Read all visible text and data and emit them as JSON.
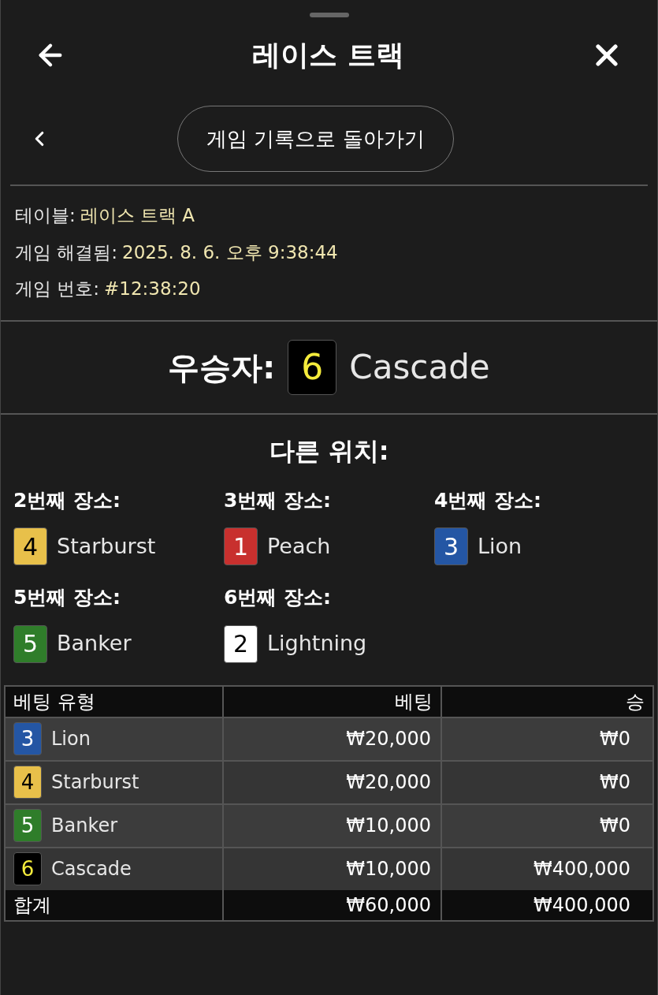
{
  "header": {
    "title": "레이스 트랙"
  },
  "back_link": {
    "label": "게임 기록으로 돌아가기"
  },
  "info": [
    {
      "label": "테이블:",
      "value": "레이스 트랙 A"
    },
    {
      "label": "게임 해결됨:",
      "value": "2025. 8. 6. 오후 9:38:44"
    },
    {
      "label": "게임 번호:",
      "value": "#12:38:20"
    }
  ],
  "winner": {
    "label": "우승자:",
    "number": "6",
    "color": "#000000",
    "name": "Cascade"
  },
  "other_positions": {
    "title": "다른 위치:",
    "items": [
      {
        "place": "2번째 장소:",
        "number": "4",
        "color": "#e8c04a",
        "name": "Starburst"
      },
      {
        "place": "3번째 장소:",
        "number": "1",
        "color": "#c8302e",
        "name": "Peach"
      },
      {
        "place": "4번째 장소:",
        "number": "3",
        "color": "#2456a4",
        "name": "Lion"
      },
      {
        "place": "5번째 장소:",
        "number": "5",
        "color": "#2f7d2a",
        "name": "Banker"
      },
      {
        "place": "6번째 장소:",
        "number": "2",
        "color": "#ffffff",
        "name": "Lightning"
      }
    ]
  },
  "bets_table": {
    "columns": [
      "베팅 유형",
      "베팅",
      "승"
    ],
    "rows": [
      {
        "number": "3",
        "color": "#2456a4",
        "name": "Lion",
        "bet": "₩20,000",
        "win": "₩0"
      },
      {
        "number": "4",
        "color": "#e8c04a",
        "name": "Starburst",
        "bet": "₩20,000",
        "win": "₩0"
      },
      {
        "number": "5",
        "color": "#2f7d2a",
        "name": "Banker",
        "bet": "₩10,000",
        "win": "₩0"
      },
      {
        "number": "6",
        "color": "#000000",
        "name": "Cascade",
        "bet": "₩10,000",
        "win": "₩400,000"
      }
    ],
    "total": {
      "label": "합계",
      "bet": "₩60,000",
      "win": "₩400,000"
    }
  }
}
